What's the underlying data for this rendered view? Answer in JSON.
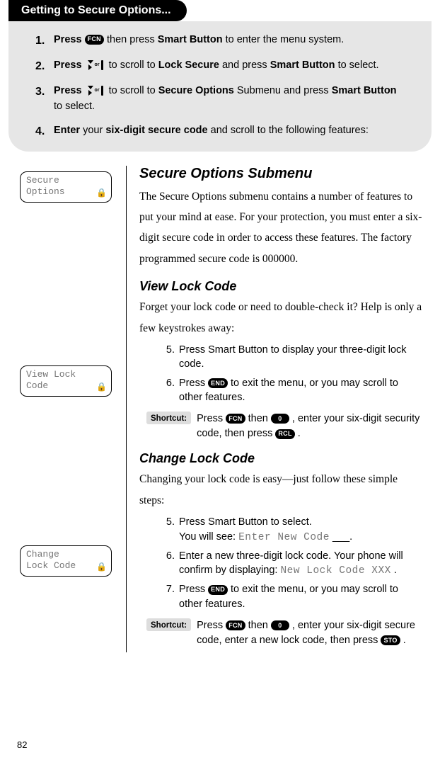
{
  "header": {
    "tab_title": "Getting to Secure Options..."
  },
  "steps": {
    "s1": {
      "num": "1.",
      "t1": "Press ",
      "t2": " then press ",
      "t3": "Smart Button",
      "t4": " to enter the menu system."
    },
    "s2": {
      "num": "2.",
      "t1": "Press ",
      "t2": " to scroll to ",
      "t3": "Lock Secure",
      "t4": " and press ",
      "t5": "Smart Button",
      "t6": " to select."
    },
    "s3": {
      "num": "3.",
      "t1": "Press ",
      "t2": " to scroll to ",
      "t3": "Secure Options",
      "t4": " Submenu and press ",
      "t5": "Smart Button",
      "t6": " to select."
    },
    "s4": {
      "num": "4.",
      "t1": "Enter",
      "t2": " your ",
      "t3": "six-digit secure code",
      "t4": " and scroll to the following features:"
    }
  },
  "keys": {
    "fcn": "FCN",
    "end": "END",
    "zero": "0",
    "rcl": "RCL",
    "sto": "STO"
  },
  "lcd": {
    "secure_options_l1": "Secure",
    "secure_options_l2": "Options",
    "view_lock_l1": "View Lock",
    "view_lock_l2": "Code",
    "change_lock_l1": "Change",
    "change_lock_l2": "Lock Code",
    "enter_new_code": "Enter New Code",
    "new_lock_code_xxx": "New Lock Code XXX"
  },
  "body": {
    "submenu_title": "Secure Options Submenu",
    "submenu_para": "The Secure Options submenu contains a number of features to put your mind at ease. For your protection, you must enter a six-digit secure code in order to access these features. The factory programmed secure code is 000000.",
    "view_lock_title": "View Lock Code",
    "view_lock_para": "Forget your lock code or need to double-check it? Help is only a few keystrokes away:",
    "view_step5": "Press Smart Button to display your three-digit lock code.",
    "view_step6a": "Press ",
    "view_step6b": " to exit the menu, or you may scroll to other features.",
    "shortcut_label": "Shortcut:",
    "shortcut1_a": "Press ",
    "shortcut1_b": " then ",
    "shortcut1_c": ", enter your six-digit security code, then press ",
    "shortcut1_d": ".",
    "change_title": "Change Lock Code",
    "change_para": "Changing your lock code is easy—just follow these simple steps:",
    "change_step5a": "Press Smart Button to select.",
    "change_step5b": "You will see: ",
    "change_step5c": " ___.",
    "change_step6a": "Enter a new three-digit lock code. Your phone will confirm by displaying: ",
    "change_step6b": ".",
    "change_step7a": "Press ",
    "change_step7b": " to exit the menu, or you may scroll to other features.",
    "shortcut2_a": "Press ",
    "shortcut2_b": " then ",
    "shortcut2_c": ", enter your six-digit secure code, enter a new lock code, then press ",
    "shortcut2_d": "."
  },
  "page_number": "82"
}
